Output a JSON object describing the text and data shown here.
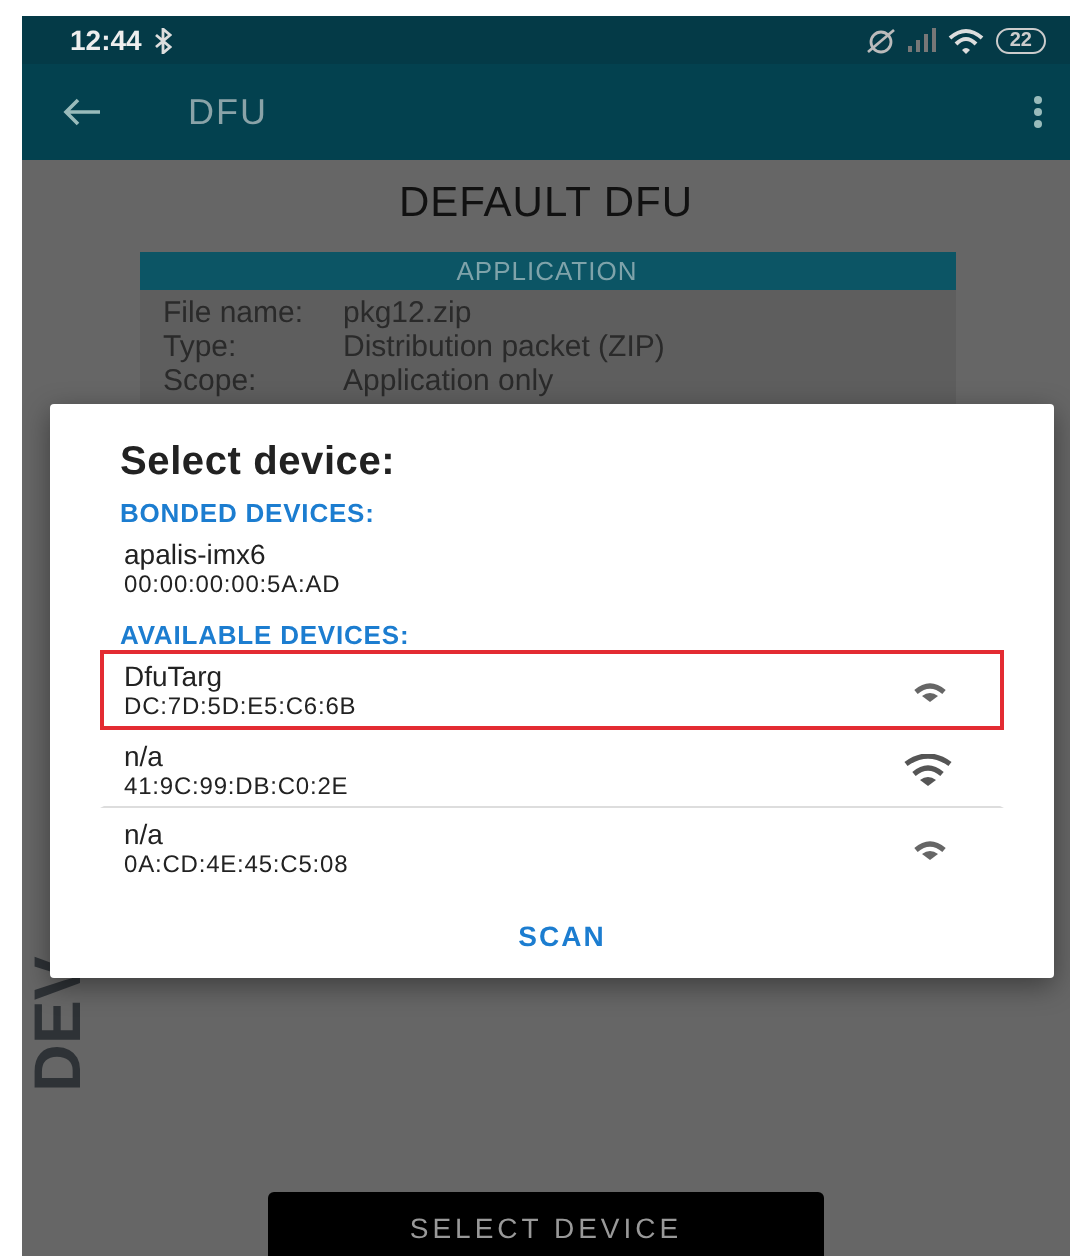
{
  "status_bar": {
    "time": "12:44",
    "battery": "22"
  },
  "app_bar": {
    "title": "DFU"
  },
  "page": {
    "heading": "DEFAULT DFU",
    "side_label": "DEV",
    "panel": {
      "title": "APPLICATION",
      "rows": [
        {
          "label": "File name:",
          "value": "pkg12.zip"
        },
        {
          "label": "Type:",
          "value": "Distribution packet (ZIP)"
        },
        {
          "label": "Scope:",
          "value": "Application only"
        }
      ]
    },
    "button": "SELECT DEVICE"
  },
  "dialog": {
    "title": "Select device:",
    "sections": [
      {
        "header": "BONDED DEVICES:",
        "devices": [
          {
            "name": "apalis-imx6",
            "address": "00:00:00:00:5A:AD",
            "highlighted": false
          }
        ]
      },
      {
        "header": "AVAILABLE DEVICES:",
        "devices": [
          {
            "name": "DfuTarg",
            "address": "DC:7D:5D:E5:C6:6B",
            "kind": "medium",
            "highlighted": true
          },
          {
            "name": "n/a",
            "address": "41:9C:99:DB:C0:2E",
            "kind": "strong",
            "highlighted": false
          },
          {
            "name": "n/a",
            "address": "0A:CD:4E:45:C5:08",
            "kind": "medium",
            "highlighted": false
          }
        ]
      }
    ],
    "action": "SCAN"
  }
}
